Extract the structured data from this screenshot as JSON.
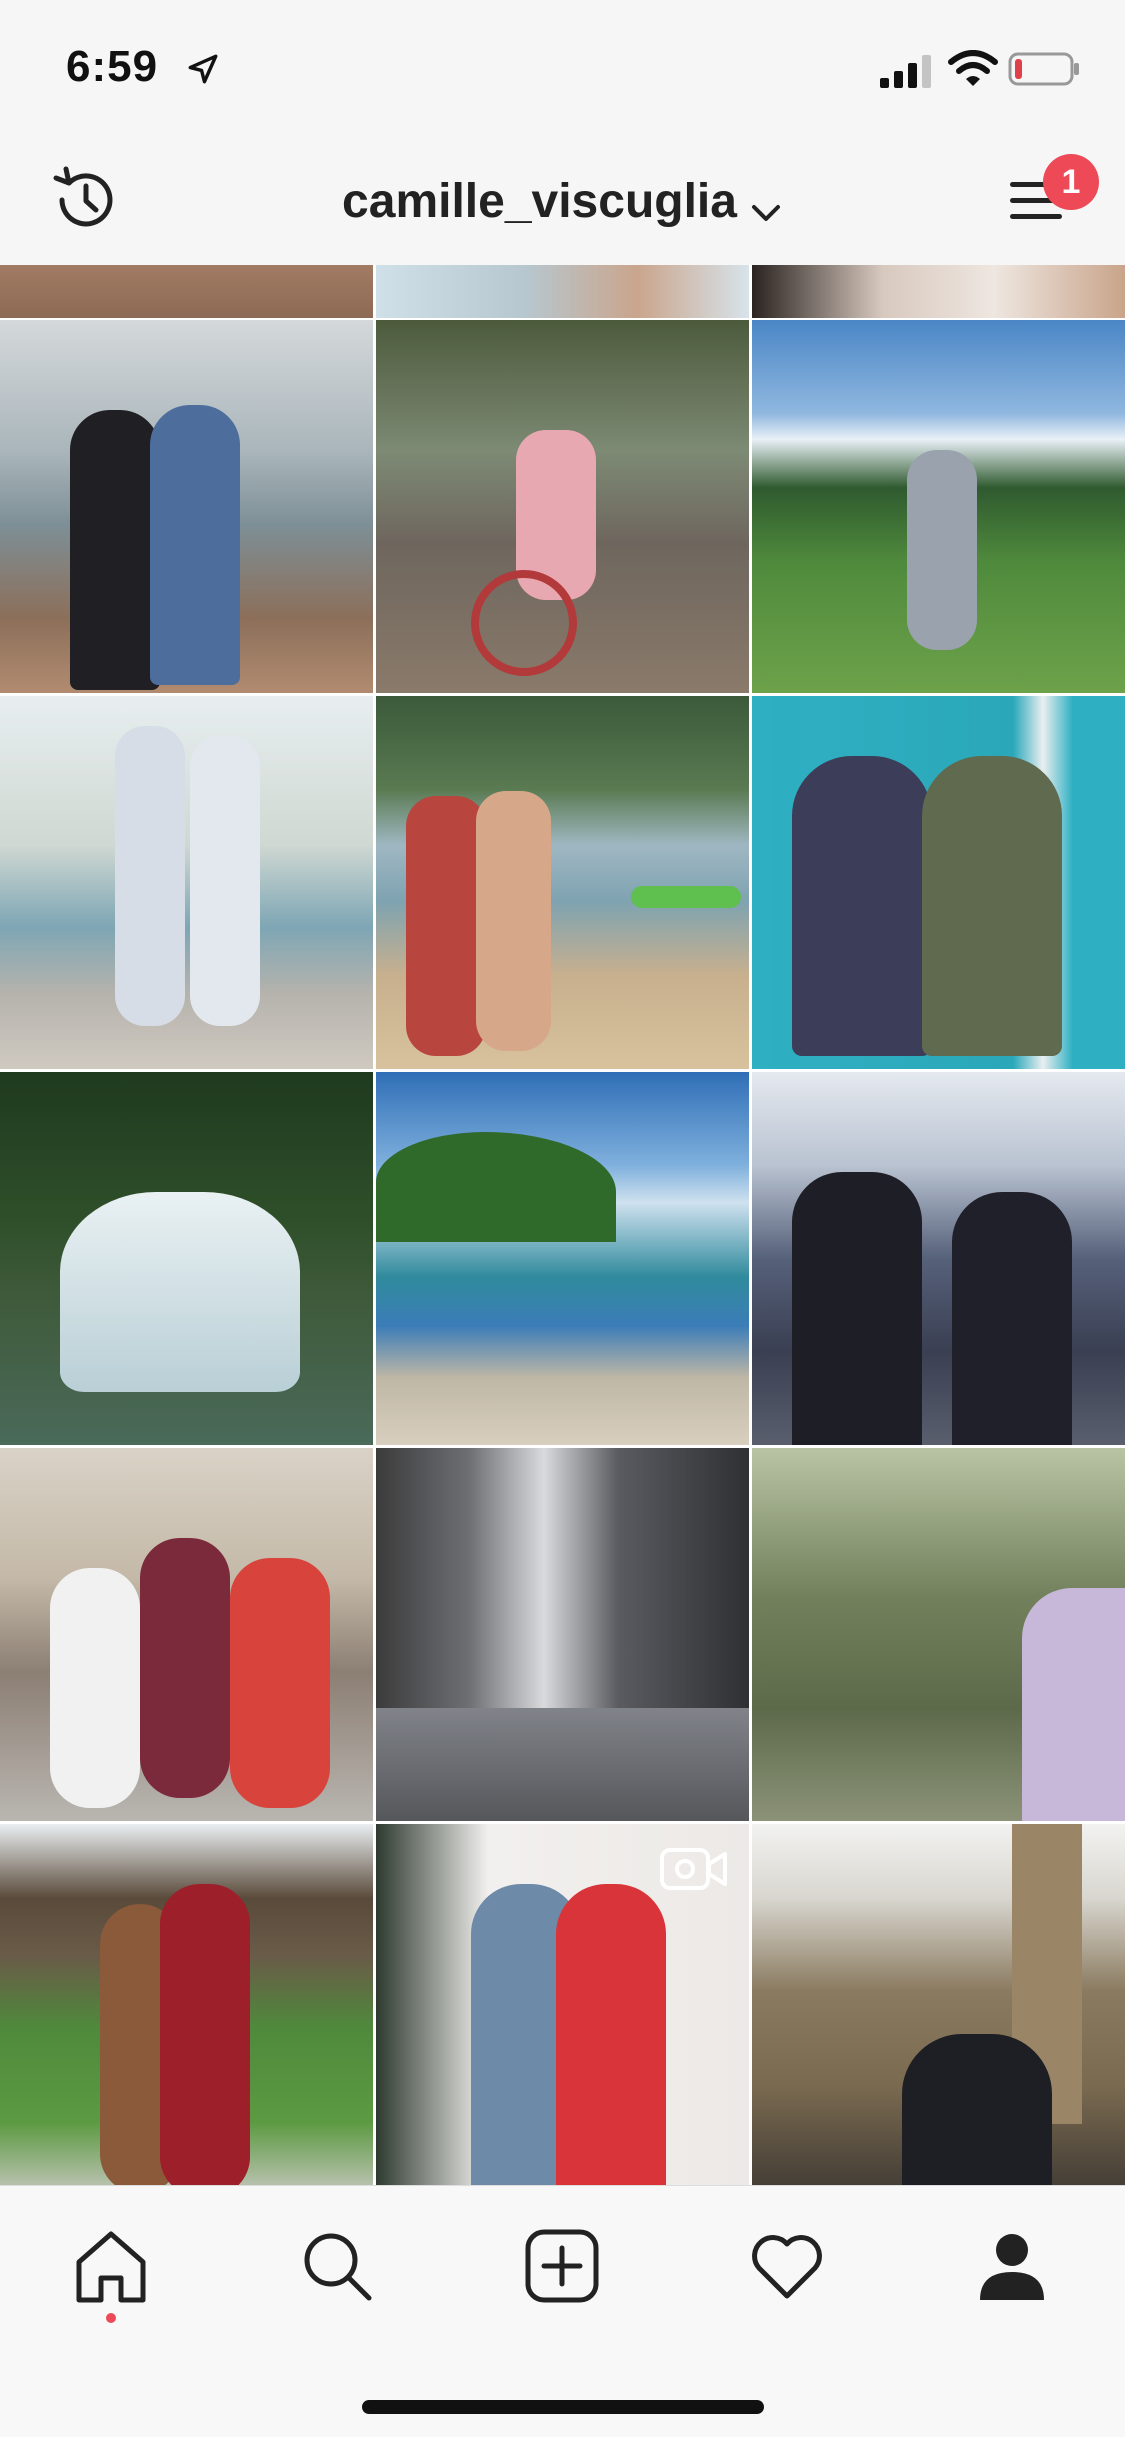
{
  "status_bar": {
    "time": "6:59",
    "icons": [
      "location-arrow-icon",
      "signal-icon",
      "wifi-icon",
      "battery-low-icon"
    ],
    "battery_color": "#e0404a"
  },
  "header": {
    "username": "camille_viscuglia",
    "left_icon": "history-icon",
    "right_icon": "menu-icon",
    "notification_count": "1",
    "badge_color": "#ed4956"
  },
  "grid": {
    "rows": [
      {
        "partial": true,
        "tiles": [
          {
            "description_color": "#c79a7e"
          },
          {
            "description_color": "#b7c7cf"
          },
          {
            "description_color": "#c9b2a1"
          }
        ]
      },
      {
        "tiles": [
          {
            "description_color": "#8e9ca2",
            "has_video": false
          },
          {
            "description_color": "#6c6a5c",
            "has_video": false
          },
          {
            "description_color": "#5a93c9",
            "has_video": false
          }
        ]
      },
      {
        "tiles": [
          {
            "description_color": "#b9c3c0",
            "has_video": false
          },
          {
            "description_color": "#8fa8b0",
            "has_video": false
          },
          {
            "description_color": "#2fb0c2",
            "has_video": false
          }
        ]
      },
      {
        "tiles": [
          {
            "description_color": "#3f5a3a",
            "has_video": false
          },
          {
            "description_color": "#3c7db8",
            "has_video": false
          },
          {
            "description_color": "#56617a",
            "has_video": false
          }
        ]
      },
      {
        "tiles": [
          {
            "description_color": "#a8625a",
            "has_video": false
          },
          {
            "description_color": "#7c7f85",
            "has_video": false
          },
          {
            "description_color": "#72805c",
            "has_video": false
          }
        ]
      },
      {
        "tiles": [
          {
            "description_color": "#5c7a3f",
            "has_video": false
          },
          {
            "description_color": "#c9b8b3",
            "has_video": true
          },
          {
            "description_color": "#8a7a5f",
            "has_video": false
          }
        ]
      }
    ]
  },
  "bottom_nav": {
    "items": [
      "home-icon",
      "search-icon",
      "new-post-icon",
      "activity-heart-icon",
      "profile-icon"
    ],
    "active": "home-icon",
    "active_dot_color": "#ed4956"
  }
}
